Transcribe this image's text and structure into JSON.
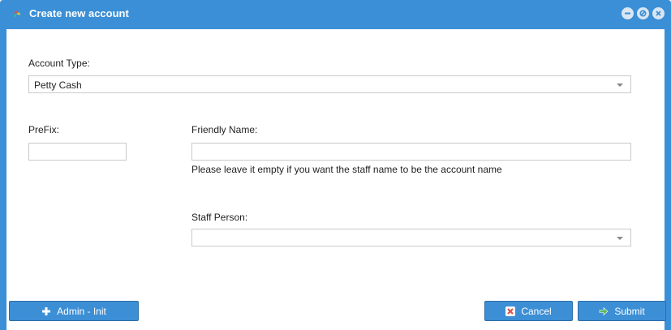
{
  "dialog": {
    "title": "Create new account",
    "window_buttons": [
      "minimize-icon",
      "restore-icon",
      "close-icon"
    ]
  },
  "form": {
    "account_type": {
      "label": "Account Type:",
      "value": "Petty Cash"
    },
    "prefix": {
      "label": "PreFix:",
      "value": ""
    },
    "friendly_name": {
      "label": "Friendly Name:",
      "value": "",
      "hint": "Please leave it empty if you want the staff name to be the account name"
    },
    "staff_person": {
      "label": "Staff Person:",
      "value": ""
    }
  },
  "footer": {
    "admin_label": "Admin - Init",
    "cancel_label": "Cancel",
    "submit_label": "Submit"
  },
  "colors": {
    "titlebar": "#3a8fd6",
    "button": "#3d8fd5",
    "cancel_icon": "#d9534f",
    "submit_icon": "#5cb85c"
  }
}
